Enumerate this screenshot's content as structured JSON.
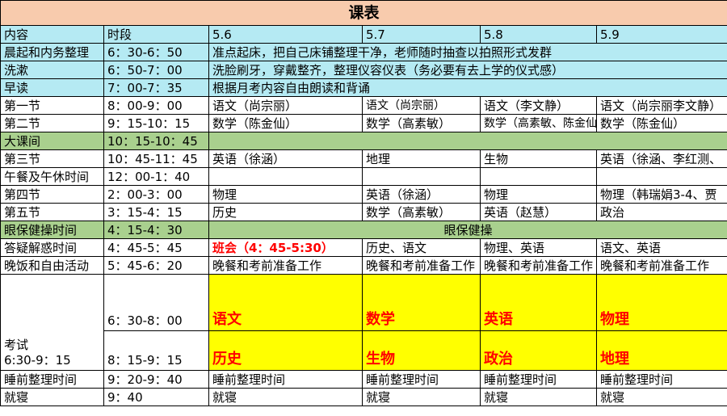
{
  "title": "课表",
  "headers": {
    "content": "内容",
    "period": "时段",
    "d1": "5.6",
    "d2": "5.7",
    "d3": "5.8",
    "d4": "5.9"
  },
  "rows": [
    {
      "content": "晨起和内务整理",
      "period": "6：30-6：50",
      "merged": "准点起床，把自己床铺整理干净，老师随时抽查以拍照形式发群"
    },
    {
      "content": "洗漱",
      "period": "6：50-7：00",
      "merged": "洗脸刷牙，穿戴整齐，整理仪容仪表（务必要有去上学的仪式感）"
    },
    {
      "content": "早读",
      "period": "7：00-7：35",
      "merged": "根据月考内容自由朗读和背诵"
    },
    {
      "content": "第一节",
      "period": "8：00-9：00",
      "d1": "语文（尚宗丽）",
      "d2": "语文（尚宗丽）",
      "d3": "语文（李文静）",
      "d4": "语文（尚宗丽李文静）"
    },
    {
      "content": "第二节",
      "period": "9：15-10：15",
      "d1": "数学（陈金仙）",
      "d2": "数学（高素敏）",
      "d3": "数学（高素敏、陈金仙）",
      "d4": "数学（陈金仙）"
    },
    {
      "content": "大课间",
      "period": "10：15-10：45"
    },
    {
      "content": "第三节",
      "period": "10：45-11：45",
      "d1": "英语（徐涵）",
      "d2": "地理",
      "d3": "生物",
      "d4": "英语（徐涵、李红测、"
    },
    {
      "content": "午餐及午休时间",
      "period": "12：00-1：40"
    },
    {
      "content": "第四节",
      "period": "2：00-3：00",
      "d1": "物理",
      "d2": "英语（徐涵）",
      "d3": "物理",
      "d4": "物理（韩瑞娟3-4、贾"
    },
    {
      "content": "第五节",
      "period": "3：15-4：15",
      "d1": "历史",
      "d2": "数学（高素敏）",
      "d3": "英语（赵慧）",
      "d4": "政治"
    },
    {
      "content": "眼保健操时间",
      "period": "4：15-4：30",
      "merged": "眼保健操"
    },
    {
      "content": "答疑解惑时间",
      "period": "4：45-5：45",
      "d1": "班会（4：45-5:30）",
      "d2": "历史、语文",
      "d3": "物理、英语",
      "d4": "语文、英语"
    },
    {
      "content": "晚饭和自由活动",
      "period": "5：45-6：20",
      "d1": "晚餐和考前准备工作",
      "d2": "晚餐和考前准备工作",
      "d3": "晚餐和考前准备工作",
      "d4": "晚餐和考前准备工作"
    }
  ],
  "exam": {
    "label": "考试",
    "label_time": "6:30-9：15",
    "sessions": [
      {
        "time": "6：30-8：00",
        "d1": "语文",
        "d2": "数学",
        "d3": "英语",
        "d4": "物理"
      },
      {
        "time": "8：15-9：15",
        "d1": "历史",
        "d2": "生物",
        "d3": "政治",
        "d4": "地理"
      }
    ]
  },
  "tail": [
    {
      "content": "睡前整理时间",
      "period": "9：20-9：40",
      "d1": "睡前整理时间",
      "d2": "睡前整理时间",
      "d3": "睡前整理时间",
      "d4": "睡前整理时间"
    },
    {
      "content": "就寝",
      "period": "9：40",
      "d1": "就寝",
      "d2": "就寝",
      "d3": "就寝",
      "d4": "就寝"
    }
  ],
  "colors": {
    "title_bg": "#f8cbad",
    "header_bg": "#b5eaf3",
    "green_bg": "#a9d08e",
    "exam_bg": "#ffff00",
    "red_text": "#ff0000"
  }
}
